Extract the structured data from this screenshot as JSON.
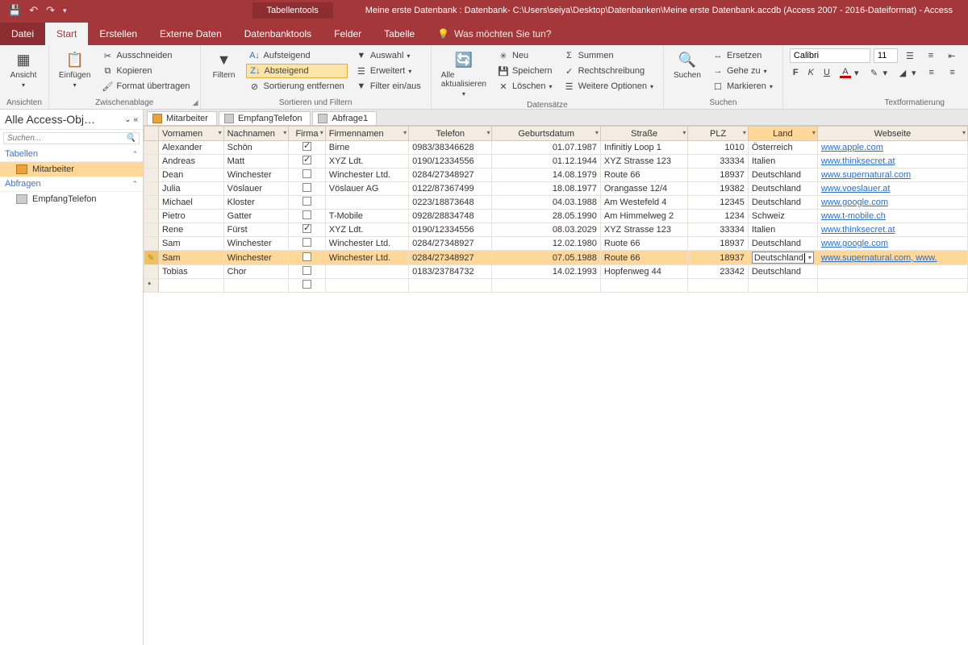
{
  "titlebar": {
    "contextual": "Tabellentools",
    "title": "Meine erste Datenbank : Datenbank- C:\\Users\\seiya\\Desktop\\Datenbanken\\Meine erste Datenbank.accdb (Access 2007 - 2016-Dateiformat)  -  Access"
  },
  "menu": {
    "file": "Datei",
    "tabs": [
      "Start",
      "Erstellen",
      "Externe Daten",
      "Datenbanktools",
      "Felder",
      "Tabelle"
    ],
    "active": "Start",
    "tellme": "Was möchten Sie tun?"
  },
  "ribbon": {
    "ansicht": "Ansicht",
    "einfuegen": "Einfügen",
    "ausschneiden": "Ausschneiden",
    "kopieren": "Kopieren",
    "format_uebertragen": "Format übertragen",
    "g_ansichten": "Ansichten",
    "g_zwischenablage": "Zwischenablage",
    "filtern": "Filtern",
    "aufsteigend": "Aufsteigend",
    "absteigend": "Absteigend",
    "sort_entfernen": "Sortierung entfernen",
    "auswahl": "Auswahl",
    "erweitert": "Erweitert",
    "filter_einaus": "Filter ein/aus",
    "g_sortfilter": "Sortieren und Filtern",
    "alle_akt": "Alle aktualisieren",
    "neu": "Neu",
    "speichern": "Speichern",
    "loeschen": "Löschen",
    "summen": "Summen",
    "recht": "Rechtschreibung",
    "weitere": "Weitere Optionen",
    "g_datensaetze": "Datensätze",
    "suchen": "Suchen",
    "ersetzen": "Ersetzen",
    "gehezu": "Gehe zu",
    "markieren": "Markieren",
    "g_suchen": "Suchen",
    "font_name": "Calibri",
    "font_size": "11",
    "g_textfmt": "Textformatierung"
  },
  "navpane": {
    "title": "Alle Access-Obj…",
    "search_ph": "Suchen...",
    "sec_tabellen": "Tabellen",
    "item_mitarbeiter": "Mitarbeiter",
    "sec_abfragen": "Abfragen",
    "item_empfang": "EmpfangTelefon"
  },
  "doctabs": [
    "Mitarbeiter",
    "EmpfangTelefon",
    "Abfrage1"
  ],
  "columns": [
    "Vornamen",
    "Nachnamen",
    "Firma",
    "Firmennamen",
    "Telefon",
    "Geburtsdatum",
    "Straße",
    "PLZ",
    "Land",
    "Webseite"
  ],
  "rows": [
    {
      "vor": "Alexander",
      "nach": "Schön",
      "firma": true,
      "firmn": "Birne",
      "tel": "0983/38346628",
      "geb": "01.07.1987",
      "str": "Infinitiy Loop 1",
      "plz": "1010",
      "land": "Österreich",
      "web": "www.apple.com"
    },
    {
      "vor": "Andreas",
      "nach": "Matt",
      "firma": true,
      "firmn": "XYZ Ldt.",
      "tel": "0190/12334556",
      "geb": "01.12.1944",
      "str": "XYZ Strasse 123",
      "plz": "33334",
      "land": "Italien",
      "web": "www.thinksecret.at"
    },
    {
      "vor": "Dean",
      "nach": "Winchester",
      "firma": false,
      "firmn": "Winchester Ltd.",
      "tel": "0284/27348927",
      "geb": "14.08.1979",
      "str": "Route 66",
      "plz": "18937",
      "land": "Deutschland",
      "web": "www.supernatural.com"
    },
    {
      "vor": "Julia",
      "nach": "Vöslauer",
      "firma": false,
      "firmn": "Vöslauer AG",
      "tel": "0122/87367499",
      "geb": "18.08.1977",
      "str": "Orangasse 12/4",
      "plz": "19382",
      "land": "Deutschland",
      "web": "www.voeslauer.at"
    },
    {
      "vor": "Michael",
      "nach": "Kloster",
      "firma": false,
      "firmn": "",
      "tel": "0223/18873648",
      "geb": "04.03.1988",
      "str": "Am Westefeld 4",
      "plz": "12345",
      "land": "Deutschland",
      "web": "www.google.com"
    },
    {
      "vor": "Pietro",
      "nach": "Gatter",
      "firma": false,
      "firmn": "T-Mobile",
      "tel": "0928/28834748",
      "geb": "28.05.1990",
      "str": "Am Himmelweg 2",
      "plz": "1234",
      "land": "Schweiz",
      "web": "www.t-mobile.ch"
    },
    {
      "vor": "Rene",
      "nach": "Fürst",
      "firma": true,
      "firmn": "XYZ Ldt.",
      "tel": "0190/12334556",
      "geb": "08.03.2029",
      "str": "XYZ Strasse 123",
      "plz": "33334",
      "land": "Italien",
      "web": "www.thinksecret.at"
    },
    {
      "vor": "Sam",
      "nach": "Winchester",
      "firma": false,
      "firmn": "Winchester Ltd.",
      "tel": "0284/27348927",
      "geb": "12.02.1980",
      "str": "Ruote 66",
      "plz": "18937",
      "land": "Deutschland",
      "web": "www.google.com"
    },
    {
      "vor": "Sam",
      "nach": "Winchester",
      "firma": false,
      "firmn": "Winchester Ltd.",
      "tel": "0284/27348927",
      "geb": "07.05.1988",
      "str": "Route 66",
      "plz": "18937",
      "land": "Deutschland",
      "web": "www.supernatural.com, www.",
      "sel": true,
      "editing": true
    },
    {
      "vor": "Tobias",
      "nach": "Chor",
      "firma": false,
      "firmn": "",
      "tel": "0183/23784732",
      "geb": "14.02.1993",
      "str": "Hopfenweg 44",
      "plz": "23342",
      "land": "Deutschland",
      "web": ""
    }
  ]
}
